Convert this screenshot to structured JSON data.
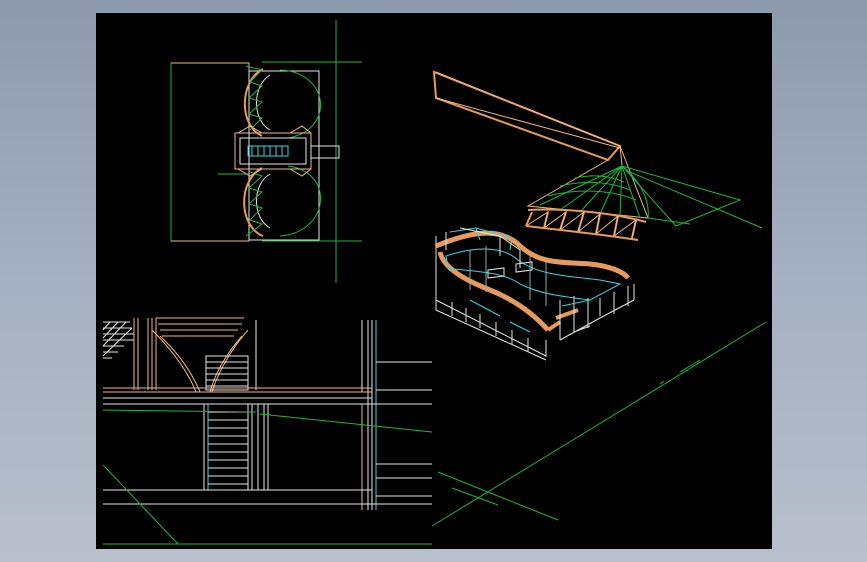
{
  "viewer": {
    "background": "#a3aec0",
    "sheet_color": "#000000"
  },
  "colors": {
    "peach": "#f0b685",
    "orange": "#e59a5e",
    "green": "#19b83a",
    "cyan": "#33d6e0",
    "white": "#e6e6e6",
    "grey": "#9aa2b0"
  },
  "views": [
    {
      "id": "plan-view",
      "kind": "floor plan"
    },
    {
      "id": "section-view",
      "kind": "section elevation"
    },
    {
      "id": "isometric-view",
      "kind": "3d wireframe"
    }
  ]
}
